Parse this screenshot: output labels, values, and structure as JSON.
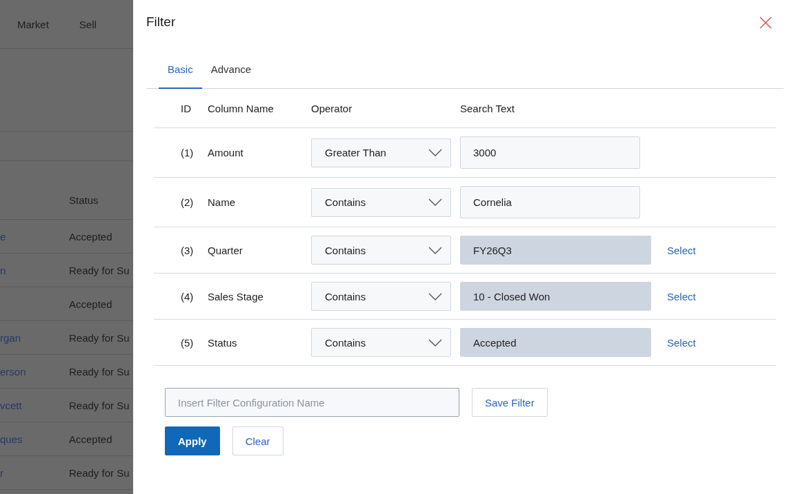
{
  "background": {
    "nav": [
      "Market",
      "Sell"
    ],
    "table": {
      "status_header": "Status",
      "rows": [
        {
          "name": "e",
          "status": "Accepted"
        },
        {
          "name": "n",
          "status": "Ready for Su"
        },
        {
          "name": "",
          "status": "Accepted"
        },
        {
          "name": "rgan",
          "status": "Ready for Su"
        },
        {
          "name": "erson",
          "status": "Ready for Su"
        },
        {
          "name": "vcett",
          "status": "Ready for Su"
        },
        {
          "name": "ques",
          "status": "Accepted"
        },
        {
          "name": "r",
          "status": "Ready for Su"
        }
      ]
    }
  },
  "dialog": {
    "title": "Filter",
    "tabs": [
      {
        "label": "Basic",
        "selected": true
      },
      {
        "label": "Advance",
        "selected": false
      }
    ],
    "columns": [
      "ID",
      "Column Name",
      "Operator",
      "Search Text"
    ],
    "rows": [
      {
        "id": "(1)",
        "column": "Amount",
        "operator": "Greater Than",
        "value": "3000",
        "kind": "text"
      },
      {
        "id": "(2)",
        "column": "Name",
        "operator": "Contains",
        "value": "Cornelia",
        "kind": "text"
      },
      {
        "id": "(3)",
        "column": "Quarter",
        "operator": "Contains",
        "value": "FY26Q3",
        "kind": "lookup",
        "action": "Select"
      },
      {
        "id": "(4)",
        "column": "Sales Stage",
        "operator": "Contains",
        "value": "10 - Closed Won",
        "kind": "lookup",
        "action": "Select"
      },
      {
        "id": "(5)",
        "column": "Status",
        "operator": "Contains",
        "value": "Accepted",
        "kind": "lookup",
        "action": "Select"
      }
    ],
    "config_name": {
      "placeholder": "Insert Filter Configuration Name"
    },
    "save_button": "Save Filter",
    "apply_button": "Apply",
    "clear_button": "Clear"
  }
}
